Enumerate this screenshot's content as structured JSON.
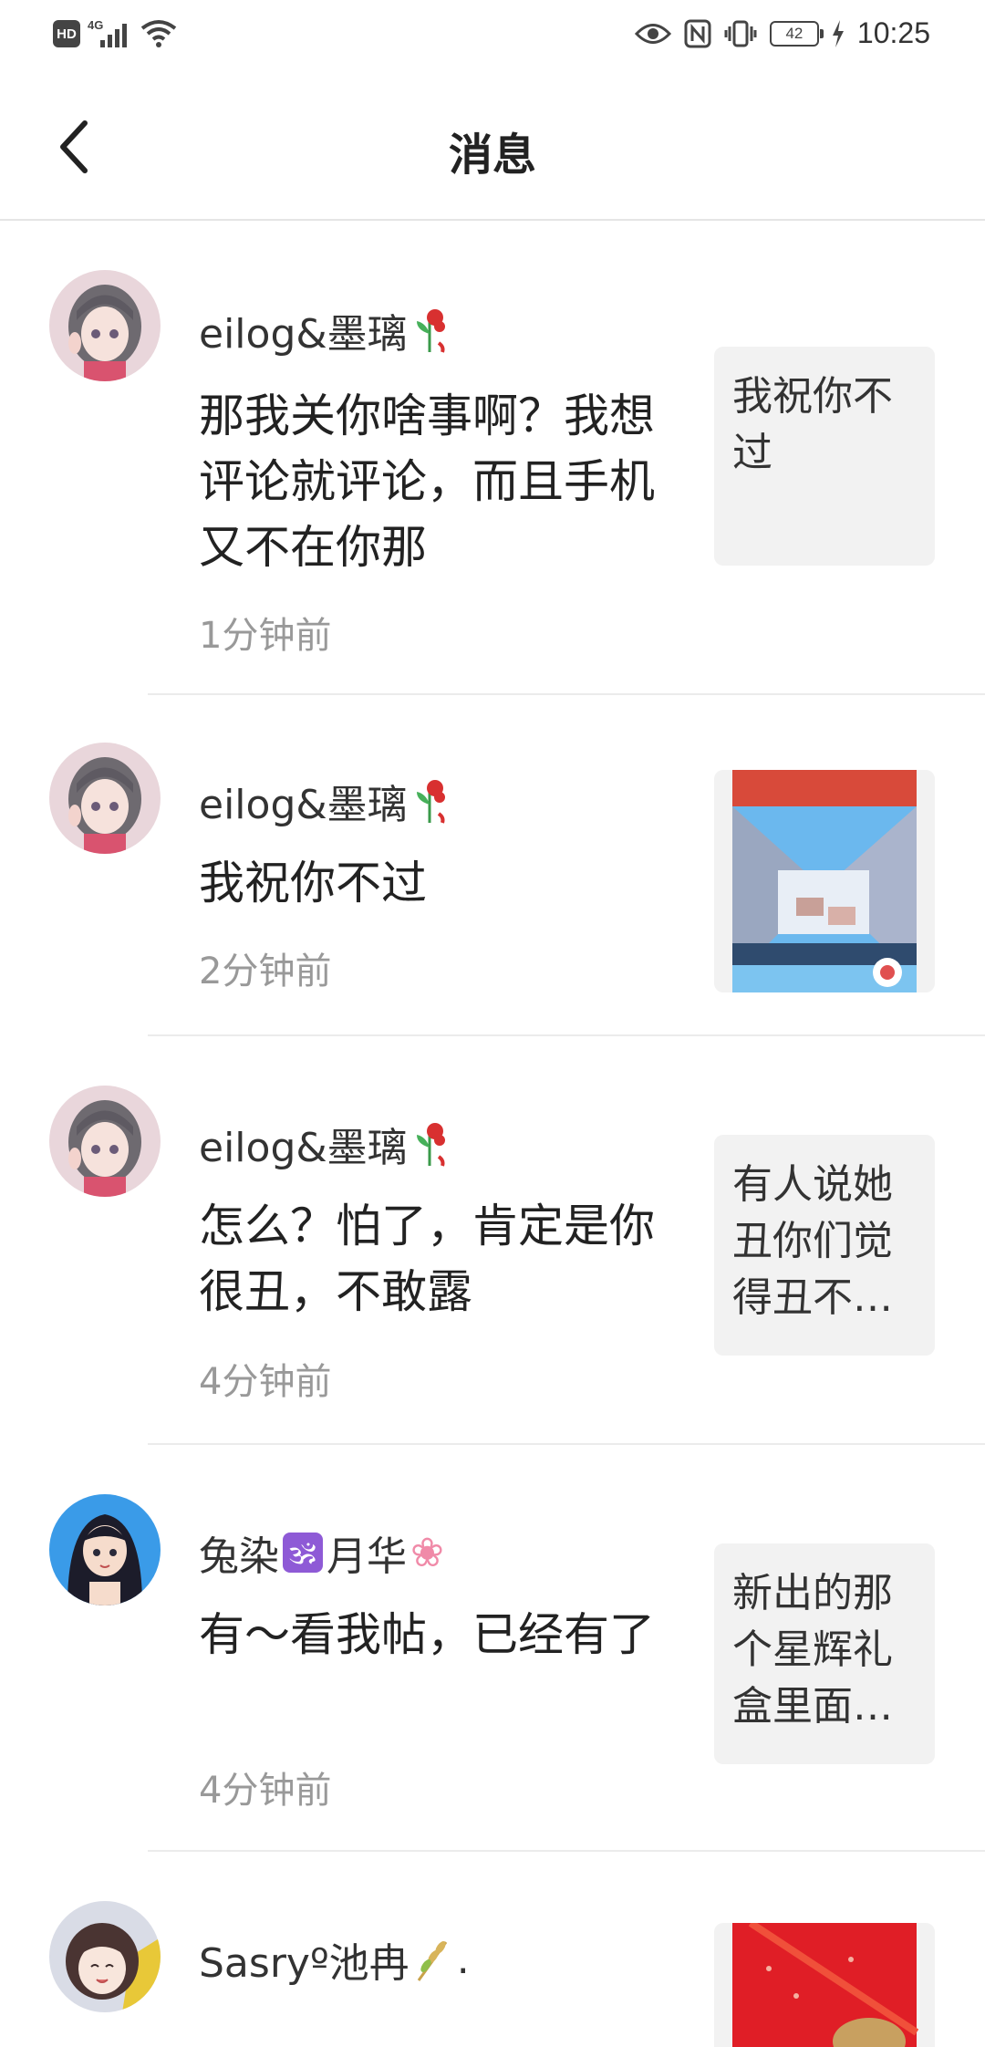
{
  "status_bar": {
    "hd_label": "HD",
    "network_label": "4G",
    "battery": "42",
    "time": "10:25"
  },
  "header": {
    "title": "消息"
  },
  "messages": [
    {
      "username": "eilog&墨璃",
      "content": "那我关你啥事啊？我想评论就评论，而且手机又不在你那",
      "time": "1分钟前",
      "preview": "我祝你不过"
    },
    {
      "username": "eilog&墨璃",
      "content": "我祝你不过",
      "time": "2分钟前",
      "preview_icon": "game-screenshot-thumbnail"
    },
    {
      "username": "eilog&墨璃",
      "content": "怎么？怕了，肯定是你很丑，不敢露",
      "time": "4分钟前",
      "preview": "有人说她丑你们觉得丑不…"
    },
    {
      "username_part1": "兔染",
      "username_symbol": "🕉",
      "username_part2": "月华",
      "username_tail": "❀",
      "content": "有～看我帖，已经有了",
      "time": "4分钟前",
      "preview": "新出的那个星辉礼盒里面…"
    },
    {
      "username": "Sasryº池冉",
      "username_tail": ".",
      "preview_icon": "red-gift-thumbnail"
    }
  ],
  "colors": {
    "time_text": "#999999",
    "preview_bg": "#f2f2f2",
    "divider": "#ebebeb"
  }
}
